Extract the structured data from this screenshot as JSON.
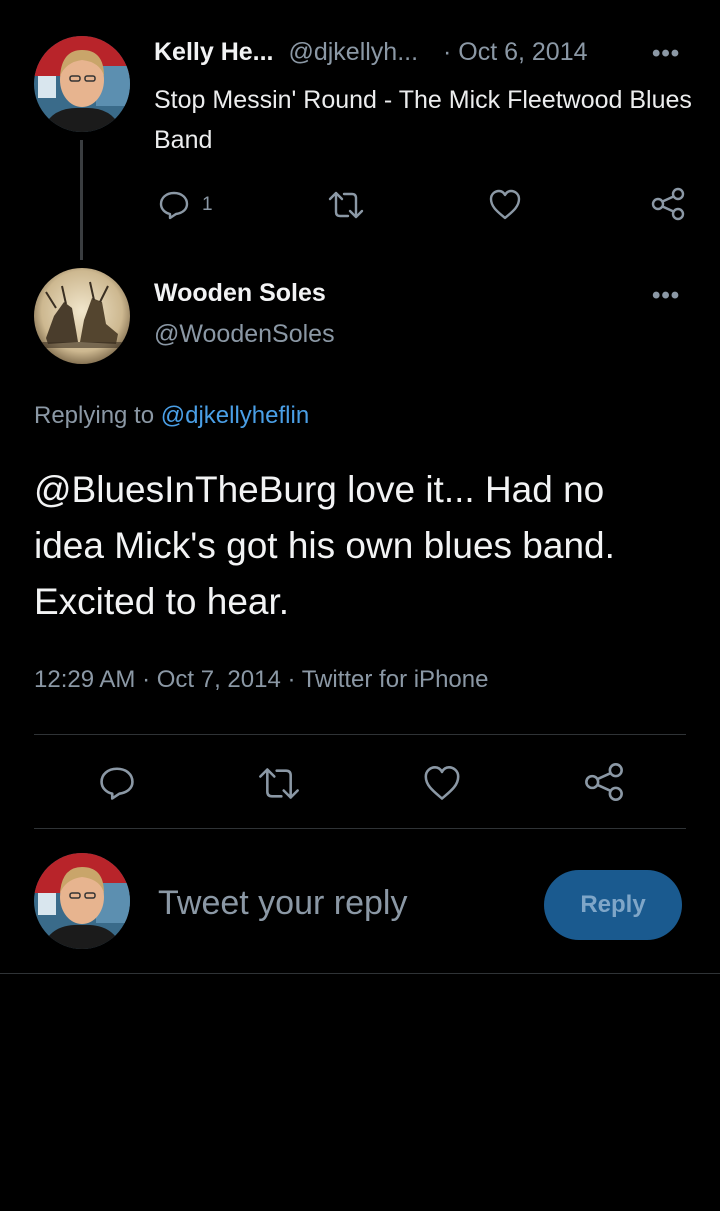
{
  "parent_tweet": {
    "author_name": "Kelly He...",
    "author_handle": "@djkellyh...",
    "date": "· Oct 6, 2014",
    "text": "Stop Messin' Round - The Mick Fleetwood Blues Band",
    "reply_count": "1",
    "icons": [
      "reply-icon",
      "retweet-icon",
      "like-icon",
      "share-icon"
    ]
  },
  "main_tweet": {
    "author_name": "Wooden Soles",
    "author_handle": "@WoodenSoles",
    "replying_prefix": "Replying to ",
    "replying_to": "@djkellyheflin",
    "text": "@BluesInTheBurg love it... Had no idea Mick's got his own blues band. Excited to hear.",
    "timestamp": "12:29 AM · Oct 7, 2014 · Twitter for iPhone"
  },
  "composer": {
    "placeholder": "Tweet your reply",
    "button_label": "Reply"
  },
  "colors": {
    "background": "#000000",
    "accent": "#4a9fe6",
    "muted": "#8b98a5",
    "reply_button": "#1a5a8f"
  }
}
